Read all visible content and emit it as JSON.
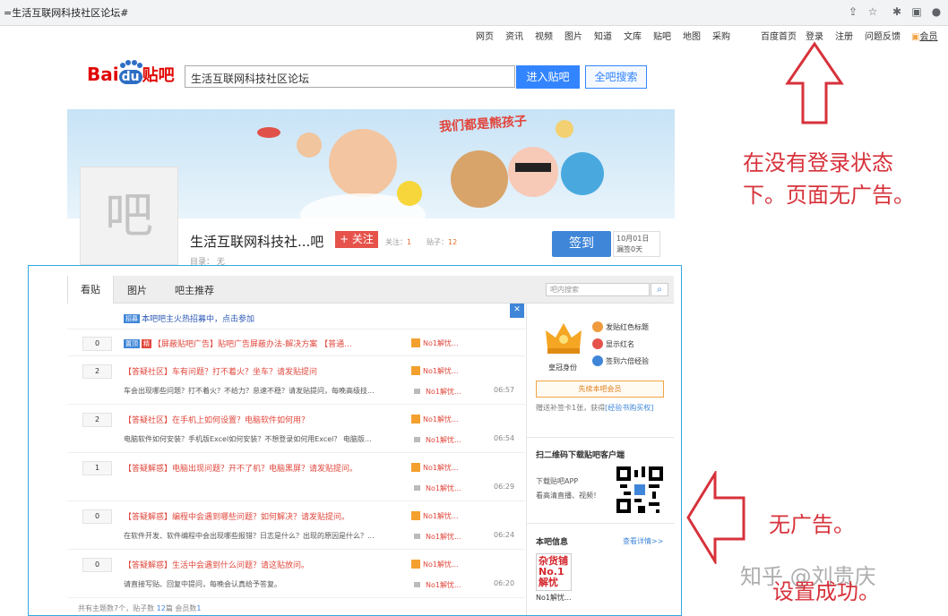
{
  "browser": {
    "url": "=生活互联网科技社区论坛#"
  },
  "topnav": {
    "items": [
      "网页",
      "资讯",
      "视频",
      "图片",
      "知道",
      "文库",
      "贴吧",
      "地图",
      "采购"
    ],
    "right": [
      "百度首页",
      "登录",
      "注册",
      "问题反馈",
      "会员"
    ]
  },
  "header": {
    "logo_a": "Bai",
    "logo_b": "du",
    "logo_c": "贴吧",
    "search_value": "生活互联网科技社区论坛",
    "enter_button": "进入贴吧",
    "all_search_button": "全吧搜索"
  },
  "banner": {
    "slogan": "我们都是熊孩子"
  },
  "forum": {
    "avatar_char": "吧",
    "title": "生活互联网科技社...吧",
    "follow_button": "+ 关注",
    "follow_label": "关注：",
    "follow_count": "1",
    "posts_label": "贴子：",
    "posts_count": "12",
    "directory": "目录：  无",
    "sign_button": "签到",
    "sign_date": "10月01日",
    "sign_streak": "漏签0天"
  },
  "tabs": [
    "看贴",
    "图片",
    "吧主推荐"
  ],
  "inner_search_placeholder": "吧内搜索",
  "threads": [
    {
      "count": "",
      "tags": [
        "招募"
      ],
      "title": "本吧吧主火热招募中，点击参加",
      "excerpt": "",
      "author": "",
      "reply": "",
      "time": ""
    },
    {
      "count": "0",
      "tags": [
        "置顶",
        "精"
      ],
      "title": "【屏蔽贴吧广告】贴吧广告屏蔽办法-解决方案 【普通...",
      "excerpt": "",
      "author": "No1解忧...",
      "reply": "",
      "time": ""
    },
    {
      "count": "2",
      "tags": [],
      "title": "【答疑社区】车有问题？打不着火？坐车？请发贴提问",
      "excerpt": "车会出现哪些问题？打不着火？不给力？怠速不稳？请发贴提问，每晚高级技...",
      "author": "No1解忧...",
      "reply": "No1解忧...",
      "time": "06:57"
    },
    {
      "count": "2",
      "tags": [],
      "title": "【答疑社区】在手机上如何设置？电脑软件如何用？",
      "excerpt": "电脑软件如何安装？手机版Excel如何安装？不想登录如何用Excel？ 电脑版...",
      "author": "No1解忧...",
      "reply": "No1解忧...",
      "time": "06:54"
    },
    {
      "count": "1",
      "tags": [],
      "title": "【答疑解惑】电脑出现问题？开不了机？电脑黑屏？请发贴提问。",
      "excerpt": "",
      "author": "No1解忧...",
      "reply": "No1解忧...",
      "time": "06:29"
    },
    {
      "count": "0",
      "tags": [],
      "title": "【答疑解惑】编程中会遇到哪些问题？如何解决？请发贴提问。",
      "excerpt": "在软件开发、软件编程中会出现哪些报错？日志是什么？出现的原因是什么？...",
      "author": "No1解忧...",
      "reply": "No1解忧...",
      "time": "06:24"
    },
    {
      "count": "0",
      "tags": [],
      "title": "【答疑解惑】生活中会遇到什么问题？请这贴放问。",
      "excerpt": "请直接写贴、回复中提问，每晚会认真给予答复。",
      "author": "No1解忧...",
      "reply": "No1解忧...",
      "time": "06:20"
    }
  ],
  "footer_stat": {
    "a": "共有主题数7个，贴子数 ",
    "b": "12",
    "c": "篇 会员数",
    "d": "1"
  },
  "side": {
    "crown_label": "皇冠身份",
    "perks": [
      "发贴红色标题",
      "显示红名",
      "签到六倍经验"
    ],
    "member_button": "先续本吧会员",
    "gift_a": "赠送补签卡1张，获得",
    "gift_b": "[经验书购买权]",
    "qr_title": "扫二维码下载贴吧客户端",
    "qr_text_1": "下载贴吧APP",
    "qr_text_2": "看高清直播、视频！",
    "info_title": "本吧信息",
    "info_more": "查看详情>>",
    "badge_text": "杂货铺 No.1 解忧",
    "badge_label": "No1解忧..."
  },
  "annotations": {
    "top_1": "在没有登录状态",
    "top_2": "下。页面无广告。",
    "bottom_1": "无广告。",
    "bottom_2": "设置成功。",
    "watermark": "知乎 @刘贵庆"
  },
  "colors": {
    "accent_blue": "#3385ff",
    "annotation_red": "#d7323b",
    "frame_cyan": "#35a8e0"
  }
}
